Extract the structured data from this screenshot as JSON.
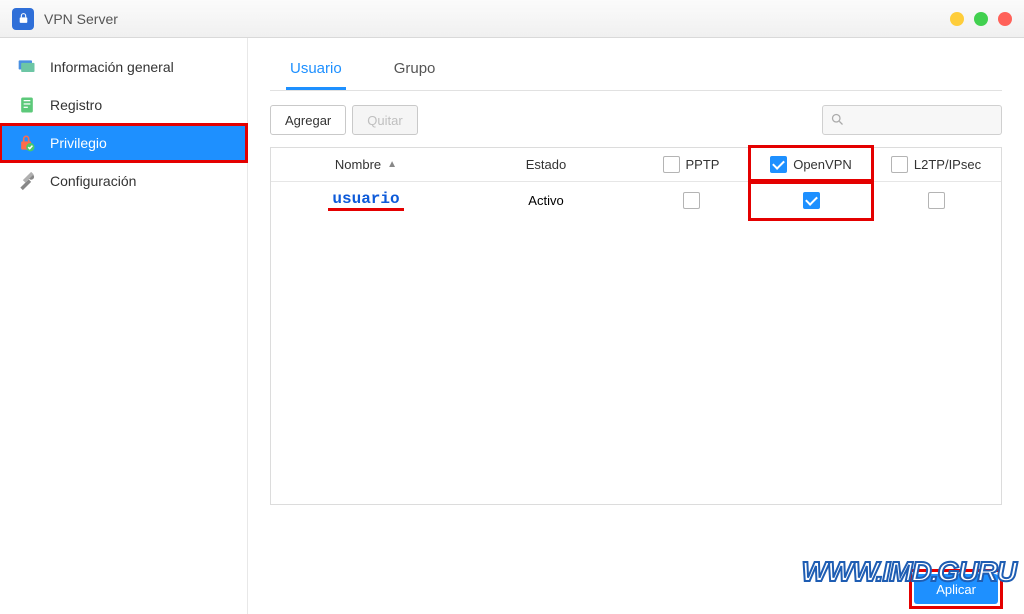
{
  "title": "VPN Server",
  "sidebar": {
    "items": [
      {
        "label": "Información general"
      },
      {
        "label": "Registro"
      },
      {
        "label": "Privilegio"
      },
      {
        "label": "Configuración"
      }
    ]
  },
  "tabs": {
    "user": "Usuario",
    "group": "Grupo"
  },
  "toolbar": {
    "add": "Agregar",
    "remove": "Quitar",
    "search_placeholder": ""
  },
  "table": {
    "headers": {
      "name": "Nombre",
      "state": "Estado",
      "pptp": "PPTP",
      "openvpn": "OpenVPN",
      "l2tp": "L2TP/IPsec"
    },
    "row": {
      "name": "usuario",
      "state": "Activo",
      "pptp": false,
      "openvpn": true,
      "l2tp": false
    },
    "header_checks": {
      "pptp": false,
      "openvpn": true,
      "l2tp": false
    }
  },
  "apply": "Aplicar",
  "watermark": "WWW.IMD.GURU"
}
